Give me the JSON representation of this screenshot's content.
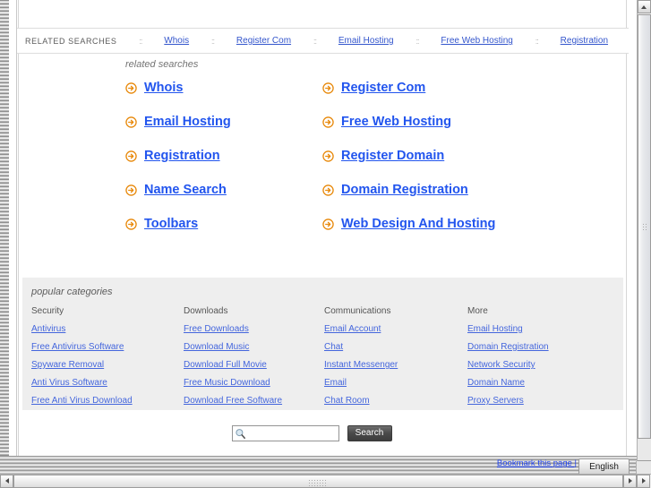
{
  "related_searches_bar": {
    "label": "RELATED SEARCHES",
    "separator": "::",
    "links": [
      "Whois",
      "Register Com",
      "Email Hosting",
      "Free Web Hosting",
      "Registration"
    ]
  },
  "related_searches": {
    "heading": "related searches",
    "icon": "circle-arrow-right-icon",
    "items": [
      "Whois",
      "Register Com",
      "Email Hosting",
      "Free Web Hosting",
      "Registration",
      "Register Domain",
      "Name Search",
      "Domain Registration",
      "Toolbars",
      "Web Design And Hosting"
    ]
  },
  "popular_categories": {
    "heading": "popular categories",
    "columns": [
      {
        "title": "Security",
        "links": [
          "Antivirus",
          "Free Antivirus Software",
          "Spyware Removal",
          "Anti Virus Software",
          "Free Anti Virus Download"
        ]
      },
      {
        "title": "Downloads",
        "links": [
          "Free Downloads",
          "Download Music",
          "Download Full Movie",
          "Free Music Download",
          "Download Free Software"
        ]
      },
      {
        "title": "Communications",
        "links": [
          "Email Account",
          "Chat",
          "Instant Messenger",
          "Email",
          "Chat Room"
        ]
      },
      {
        "title": "More",
        "links": [
          "Email Hosting",
          "Domain Registration",
          "Network Security",
          "Domain Name",
          "Proxy Servers"
        ]
      }
    ]
  },
  "search": {
    "icon": "magnifier-icon",
    "value": "",
    "placeholder": "",
    "button_label": "Search"
  },
  "footer": {
    "bookmark_label": "Bookmark this page |",
    "language_label": "English"
  },
  "scrollbars": {
    "vertical_up_icon": "triangle-up-icon",
    "vertical_down_icon": "triangle-down-icon",
    "horizontal_left_icon": "triangle-left-icon",
    "horizontal_right_icon": "triangle-right-icon"
  },
  "colors": {
    "link_blue": "#2255ee",
    "bar_link_blue": "#3355cc",
    "arrow_orange": "#e8890b",
    "panel_gray": "#eeeeee"
  }
}
